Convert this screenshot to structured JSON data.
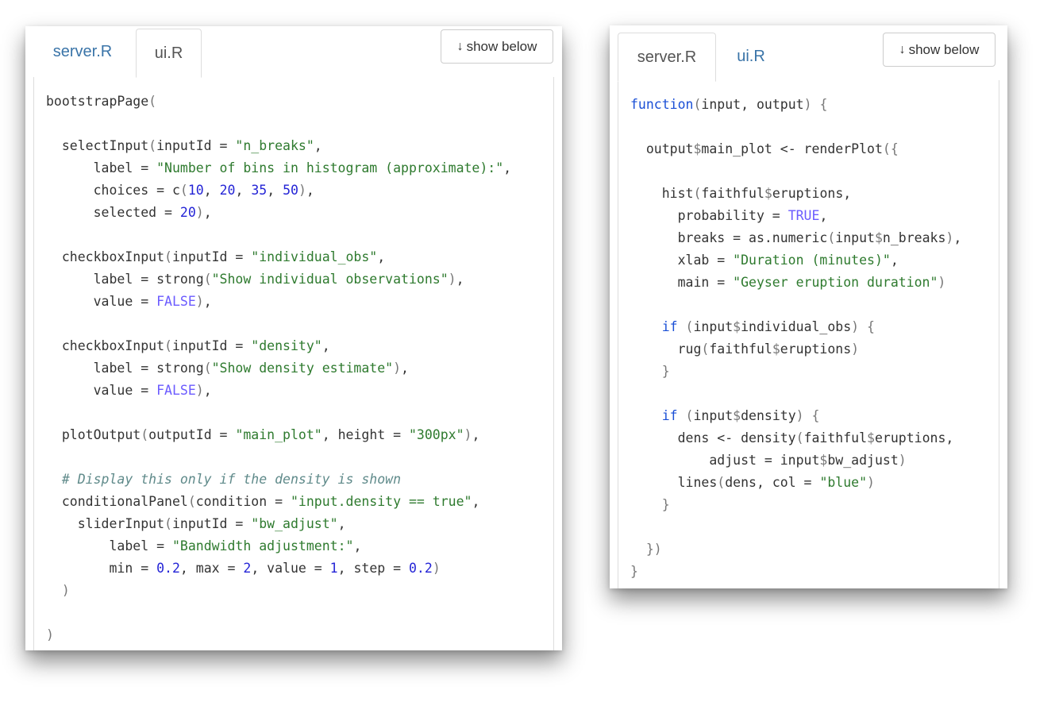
{
  "left_panel": {
    "tabs": [
      {
        "label": "server.R",
        "active": false
      },
      {
        "label": "ui.R",
        "active": true
      }
    ],
    "show_below_label": "show below",
    "show_below_icon": "arrow-down-icon",
    "file": "ui.R"
  },
  "right_panel": {
    "tabs": [
      {
        "label": "server.R",
        "active": true
      },
      {
        "label": "ui.R",
        "active": false
      }
    ],
    "show_below_label": "show below",
    "show_below_icon": "arrow-down-icon",
    "file": "server.R"
  },
  "colors": {
    "tab_link": "#3a74a8",
    "tab_active": "#555555",
    "keyword": "#1a4fd6",
    "string": "#2e7a2e",
    "number": "#2424d6",
    "constant": "#6b5bff",
    "comment": "#5f8a8a"
  },
  "ui_code": [
    [
      [
        "t",
        "bootstrapPage"
      ],
      [
        "p",
        "("
      ]
    ],
    [],
    [
      [
        "t",
        "  selectInput"
      ],
      [
        "p",
        "("
      ],
      [
        "t",
        "inputId = "
      ],
      [
        "s",
        "\"n_breaks\""
      ],
      [
        "t",
        ","
      ]
    ],
    [
      [
        "t",
        "      label = "
      ],
      [
        "s",
        "\"Number of bins in histogram (approximate):\""
      ],
      [
        "t",
        ","
      ]
    ],
    [
      [
        "t",
        "      choices = c"
      ],
      [
        "p",
        "("
      ],
      [
        "n",
        "10"
      ],
      [
        "t",
        ", "
      ],
      [
        "n",
        "20"
      ],
      [
        "t",
        ", "
      ],
      [
        "n",
        "35"
      ],
      [
        "t",
        ", "
      ],
      [
        "n",
        "50"
      ],
      [
        "p",
        ")"
      ],
      [
        "t",
        ","
      ]
    ],
    [
      [
        "t",
        "      selected = "
      ],
      [
        "n",
        "20"
      ],
      [
        "p",
        ")"
      ],
      [
        "t",
        ","
      ]
    ],
    [],
    [
      [
        "t",
        "  checkboxInput"
      ],
      [
        "p",
        "("
      ],
      [
        "t",
        "inputId = "
      ],
      [
        "s",
        "\"individual_obs\""
      ],
      [
        "t",
        ","
      ]
    ],
    [
      [
        "t",
        "      label = strong"
      ],
      [
        "p",
        "("
      ],
      [
        "s",
        "\"Show individual observations\""
      ],
      [
        "p",
        ")"
      ],
      [
        "t",
        ","
      ]
    ],
    [
      [
        "t",
        "      value = "
      ],
      [
        "c",
        "FALSE"
      ],
      [
        "p",
        ")"
      ],
      [
        "t",
        ","
      ]
    ],
    [],
    [
      [
        "t",
        "  checkboxInput"
      ],
      [
        "p",
        "("
      ],
      [
        "t",
        "inputId = "
      ],
      [
        "s",
        "\"density\""
      ],
      [
        "t",
        ","
      ]
    ],
    [
      [
        "t",
        "      label = strong"
      ],
      [
        "p",
        "("
      ],
      [
        "s",
        "\"Show density estimate\""
      ],
      [
        "p",
        ")"
      ],
      [
        "t",
        ","
      ]
    ],
    [
      [
        "t",
        "      value = "
      ],
      [
        "c",
        "FALSE"
      ],
      [
        "p",
        ")"
      ],
      [
        "t",
        ","
      ]
    ],
    [],
    [
      [
        "t",
        "  plotOutput"
      ],
      [
        "p",
        "("
      ],
      [
        "t",
        "outputId = "
      ],
      [
        "s",
        "\"main_plot\""
      ],
      [
        "t",
        ", height = "
      ],
      [
        "s",
        "\"300px\""
      ],
      [
        "p",
        ")"
      ],
      [
        "t",
        ","
      ]
    ],
    [],
    [
      [
        "m",
        "  # Display this only if the density is shown"
      ]
    ],
    [
      [
        "t",
        "  conditionalPanel"
      ],
      [
        "p",
        "("
      ],
      [
        "t",
        "condition = "
      ],
      [
        "s",
        "\"input.density == true\""
      ],
      [
        "t",
        ","
      ]
    ],
    [
      [
        "t",
        "    sliderInput"
      ],
      [
        "p",
        "("
      ],
      [
        "t",
        "inputId = "
      ],
      [
        "s",
        "\"bw_adjust\""
      ],
      [
        "t",
        ","
      ]
    ],
    [
      [
        "t",
        "        label = "
      ],
      [
        "s",
        "\"Bandwidth adjustment:\""
      ],
      [
        "t",
        ","
      ]
    ],
    [
      [
        "t",
        "        min = "
      ],
      [
        "n",
        "0.2"
      ],
      [
        "t",
        ", max = "
      ],
      [
        "n",
        "2"
      ],
      [
        "t",
        ", value = "
      ],
      [
        "n",
        "1"
      ],
      [
        "t",
        ", step = "
      ],
      [
        "n",
        "0.2"
      ],
      [
        "p",
        ")"
      ]
    ],
    [
      [
        "p",
        "  )"
      ]
    ],
    [],
    [
      [
        "p",
        ")"
      ]
    ]
  ],
  "server_code": [
    [
      [
        "k",
        "function"
      ],
      [
        "p",
        "("
      ],
      [
        "t",
        "input, output"
      ],
      [
        "p",
        ")"
      ],
      [
        "t",
        " "
      ],
      [
        "p",
        "{"
      ]
    ],
    [],
    [
      [
        "t",
        "  output"
      ],
      [
        "p",
        "$"
      ],
      [
        "t",
        "main_plot <- renderPlot"
      ],
      [
        "p",
        "({"
      ]
    ],
    [],
    [
      [
        "t",
        "    hist"
      ],
      [
        "p",
        "("
      ],
      [
        "t",
        "faithful"
      ],
      [
        "p",
        "$"
      ],
      [
        "t",
        "eruptions,"
      ]
    ],
    [
      [
        "t",
        "      probability = "
      ],
      [
        "c",
        "TRUE"
      ],
      [
        "t",
        ","
      ]
    ],
    [
      [
        "t",
        "      breaks = as.numeric"
      ],
      [
        "p",
        "("
      ],
      [
        "t",
        "input"
      ],
      [
        "p",
        "$"
      ],
      [
        "t",
        "n_breaks"
      ],
      [
        "p",
        ")"
      ],
      [
        "t",
        ","
      ]
    ],
    [
      [
        "t",
        "      xlab = "
      ],
      [
        "s",
        "\"Duration (minutes)\""
      ],
      [
        "t",
        ","
      ]
    ],
    [
      [
        "t",
        "      main = "
      ],
      [
        "s",
        "\"Geyser eruption duration\""
      ],
      [
        "p",
        ")"
      ]
    ],
    [],
    [
      [
        "k",
        "    if"
      ],
      [
        "t",
        " "
      ],
      [
        "p",
        "("
      ],
      [
        "t",
        "input"
      ],
      [
        "p",
        "$"
      ],
      [
        "t",
        "individual_obs"
      ],
      [
        "p",
        ")"
      ],
      [
        "t",
        " "
      ],
      [
        "p",
        "{"
      ]
    ],
    [
      [
        "t",
        "      rug"
      ],
      [
        "p",
        "("
      ],
      [
        "t",
        "faithful"
      ],
      [
        "p",
        "$"
      ],
      [
        "t",
        "eruptions"
      ],
      [
        "p",
        ")"
      ]
    ],
    [
      [
        "p",
        "    }"
      ]
    ],
    [],
    [
      [
        "k",
        "    if"
      ],
      [
        "t",
        " "
      ],
      [
        "p",
        "("
      ],
      [
        "t",
        "input"
      ],
      [
        "p",
        "$"
      ],
      [
        "t",
        "density"
      ],
      [
        "p",
        ")"
      ],
      [
        "t",
        " "
      ],
      [
        "p",
        "{"
      ]
    ],
    [
      [
        "t",
        "      dens <- density"
      ],
      [
        "p",
        "("
      ],
      [
        "t",
        "faithful"
      ],
      [
        "p",
        "$"
      ],
      [
        "t",
        "eruptions,"
      ]
    ],
    [
      [
        "t",
        "          adjust = input"
      ],
      [
        "p",
        "$"
      ],
      [
        "t",
        "bw_adjust"
      ],
      [
        "p",
        ")"
      ]
    ],
    [
      [
        "t",
        "      lines"
      ],
      [
        "p",
        "("
      ],
      [
        "t",
        "dens, col = "
      ],
      [
        "s",
        "\"blue\""
      ],
      [
        "p",
        ")"
      ]
    ],
    [
      [
        "p",
        "    }"
      ]
    ],
    [],
    [
      [
        "p",
        "  })"
      ]
    ],
    [
      [
        "p",
        "}"
      ]
    ]
  ]
}
